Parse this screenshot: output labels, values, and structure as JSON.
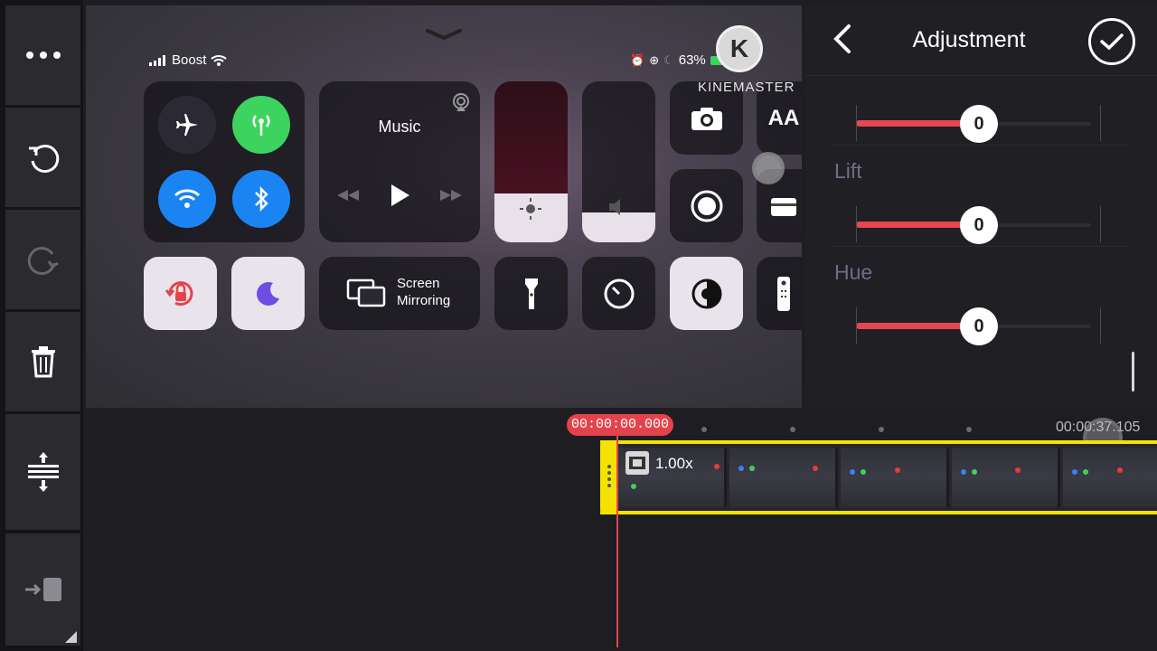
{
  "toolbar": {
    "items": [
      {
        "name": "more-icon"
      },
      {
        "name": "undo-icon"
      },
      {
        "name": "redo-icon"
      },
      {
        "name": "trash-icon"
      },
      {
        "name": "timeline-expand-icon"
      },
      {
        "name": "export-icon"
      }
    ]
  },
  "preview": {
    "status": {
      "carrier": "Boost",
      "battery": "63%"
    },
    "music_title": "Music",
    "screen_mirroring_line1": "Screen",
    "screen_mirroring_line2": "Mirroring",
    "text_size_label": "AA",
    "watermark": {
      "logo_letter": "K",
      "brand": "KINEMASTER"
    }
  },
  "panel": {
    "title": "Adjustment",
    "sliders": [
      {
        "label": "",
        "value": "0"
      },
      {
        "label": "Lift",
        "value": "0"
      },
      {
        "label": "Hue",
        "value": "0"
      }
    ]
  },
  "timeline": {
    "current_time": "00:00:00.000",
    "end_time": "00:00:37.105",
    "clip_speed": "1.00x"
  },
  "colors": {
    "accent_red": "#e5434c",
    "clip_border": "#f4e300",
    "green_toggle": "#3dd35f",
    "blue_toggle": "#1a84f3"
  }
}
